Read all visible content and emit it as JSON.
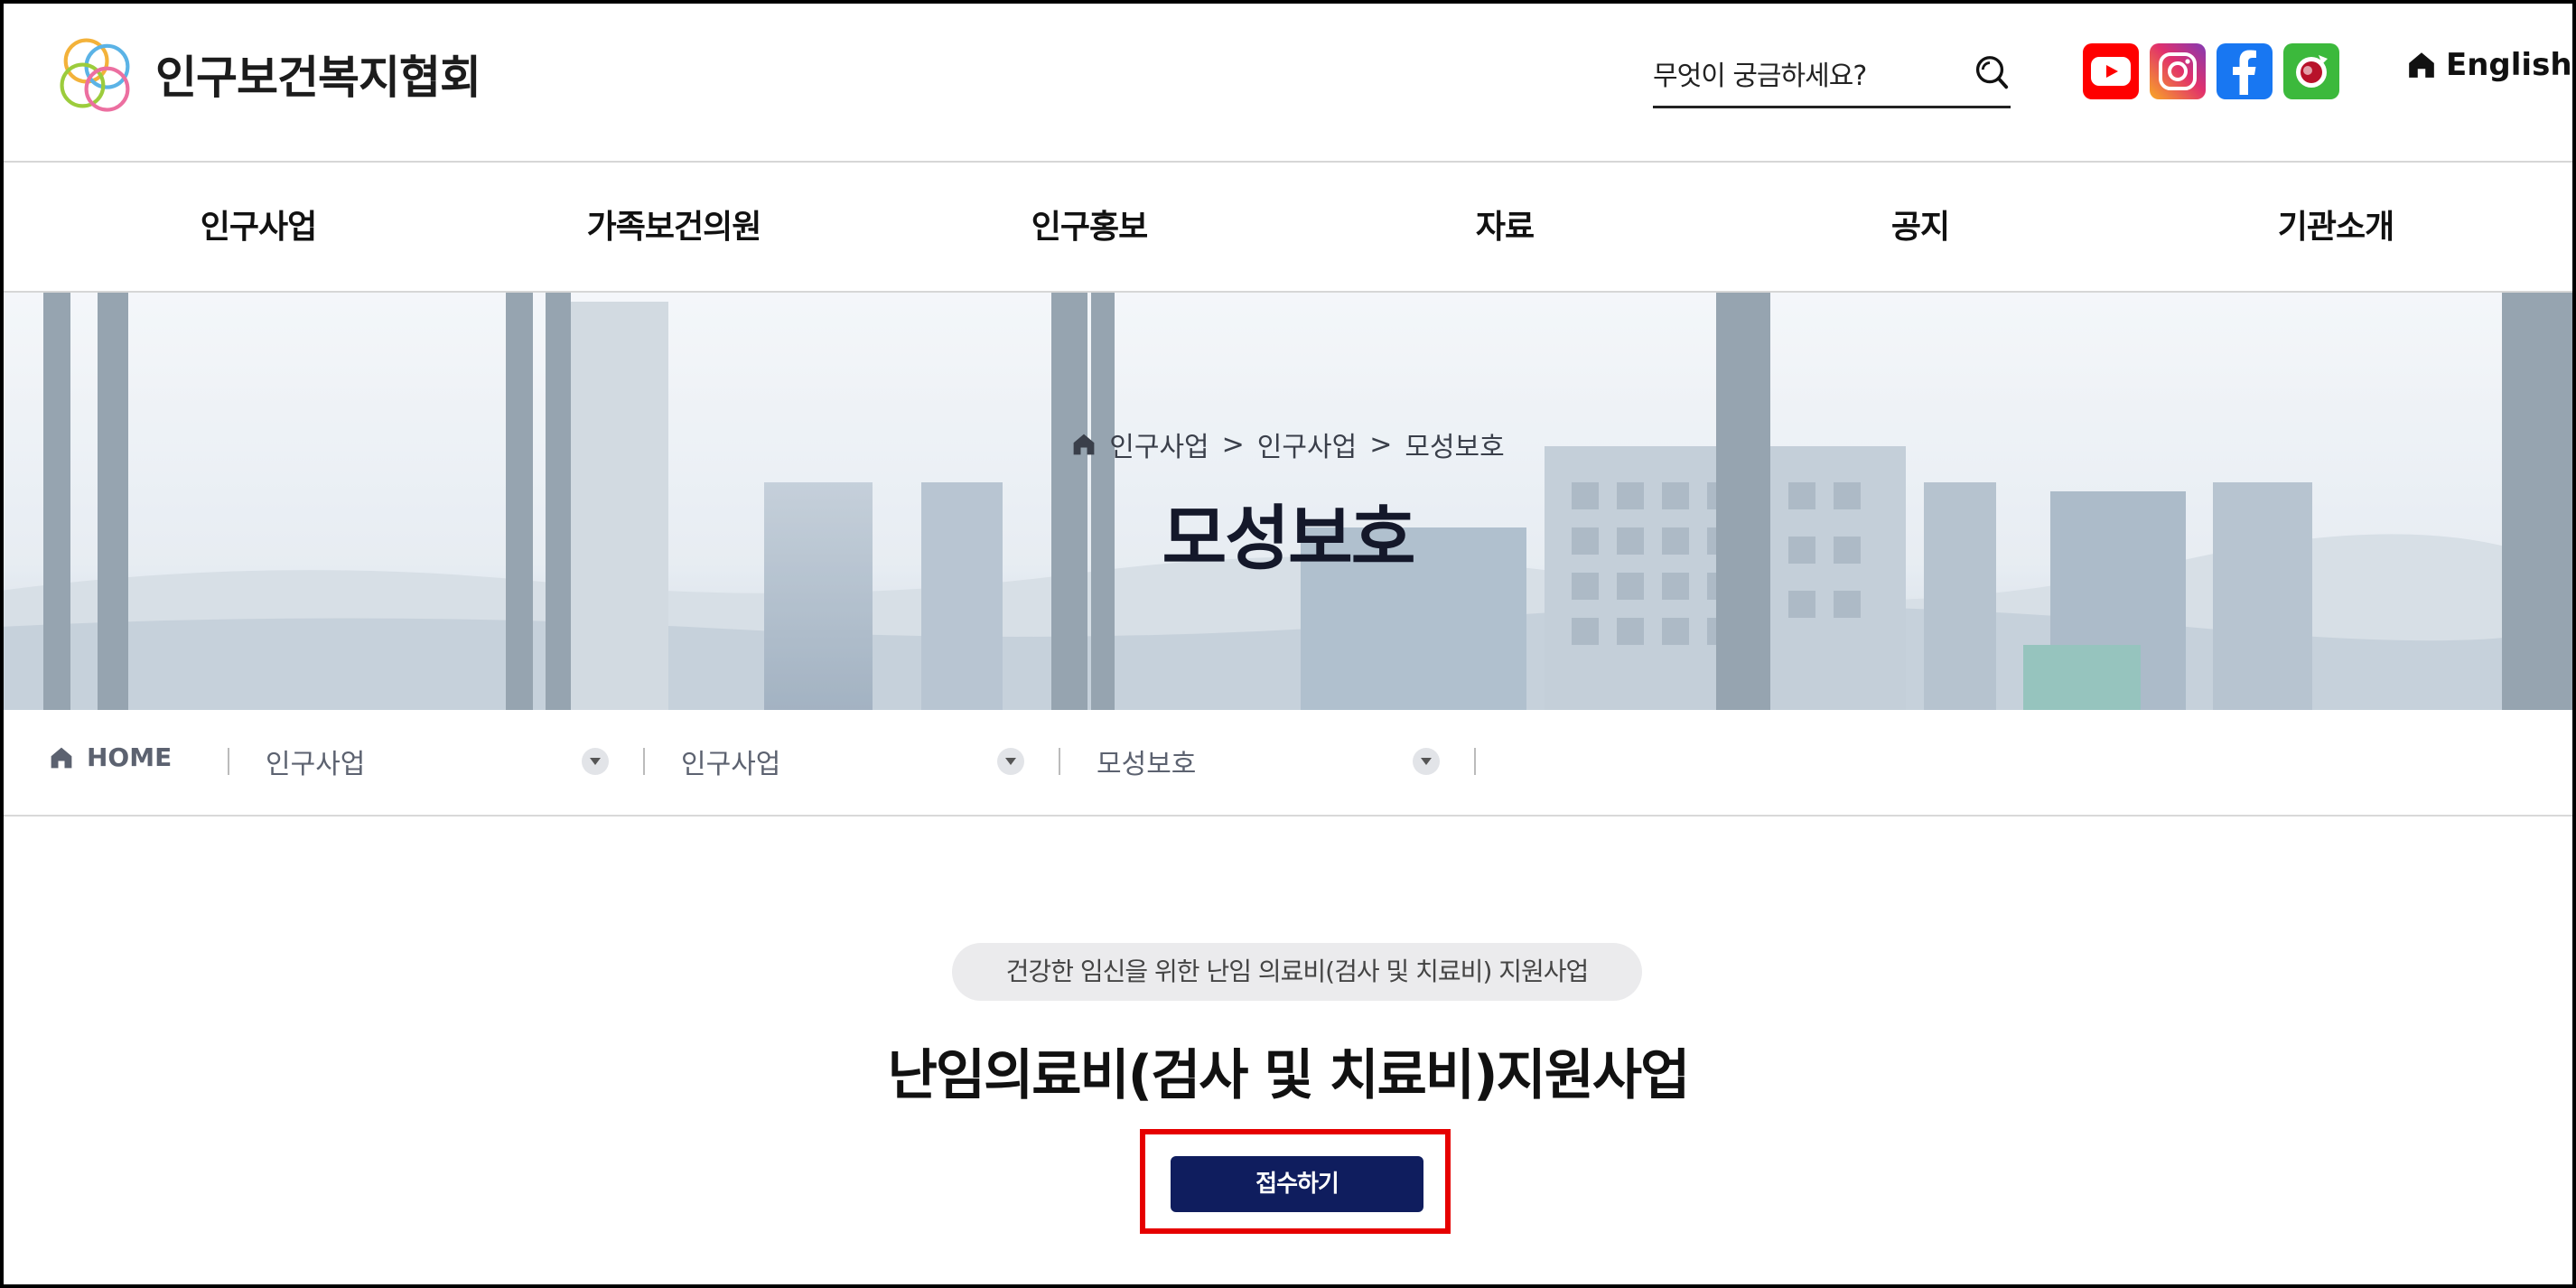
{
  "header": {
    "logo_text": "인구보건복지협회",
    "search_placeholder": "무엇이 궁금하세요?",
    "social": [
      "youtube-icon",
      "instagram-icon",
      "facebook-icon",
      "channel-icon"
    ],
    "language_label": "English"
  },
  "nav": {
    "items": [
      {
        "label": "인구사업"
      },
      {
        "label": "가족보건의원"
      },
      {
        "label": "인구홍보"
      },
      {
        "label": "자료"
      },
      {
        "label": "공지"
      },
      {
        "label": "기관소개"
      }
    ]
  },
  "hero": {
    "breadcrumb": [
      "인구사업",
      "인구사업",
      "모성보호"
    ],
    "breadcrumb_separator": ">",
    "title": "모성보호"
  },
  "location": {
    "home_label": "HOME",
    "dropdowns": [
      "인구사업",
      "인구사업",
      "모성보호"
    ]
  },
  "content": {
    "subtitle": "건강한 임신을 위한 난임 의료비(검사 및 치료비) 지원사업",
    "title": "난임의료비(검사 및 치료비)지원사업",
    "apply_button": "접수하기"
  },
  "colors": {
    "button_bg": "#0f1d5e",
    "highlight": "#e60000"
  }
}
